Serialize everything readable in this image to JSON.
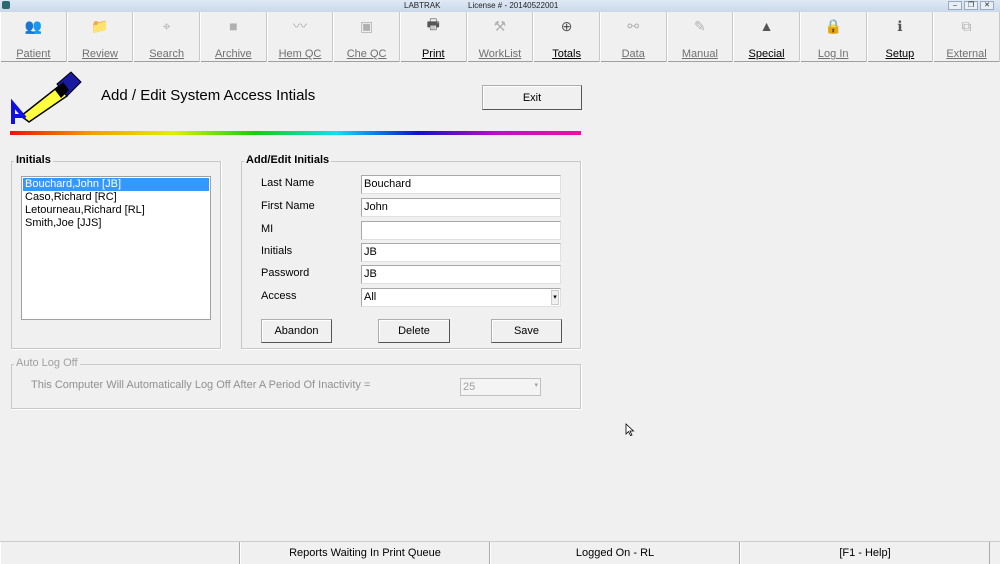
{
  "window": {
    "app_title": "LABTRAK",
    "license": "License # - 20140522001",
    "controls": [
      "minimize",
      "restore",
      "close"
    ]
  },
  "toolbar": [
    {
      "label": "Patient",
      "icon": "patient-icon",
      "glyph": "👥",
      "enabled": false
    },
    {
      "label": "Review",
      "icon": "review-icon",
      "glyph": "📁",
      "enabled": false
    },
    {
      "label": "Search",
      "icon": "search-icon",
      "glyph": "⌖",
      "enabled": false
    },
    {
      "label": "Archive",
      "icon": "archive-icon",
      "glyph": "■",
      "enabled": false
    },
    {
      "label": "Hem QC",
      "icon": "hem-qc-icon",
      "glyph": "〰",
      "enabled": false
    },
    {
      "label": "Che QC",
      "icon": "che-qc-icon",
      "glyph": "▣",
      "enabled": false
    },
    {
      "label": "Print",
      "icon": "printer-icon",
      "glyph": "🖶",
      "enabled": true
    },
    {
      "label": "WorkList",
      "icon": "worklist-icon",
      "glyph": "⚒",
      "enabled": false
    },
    {
      "label": "Totals",
      "icon": "totals-icon",
      "glyph": "⊕",
      "enabled": true
    },
    {
      "label": "Data",
      "icon": "data-icon",
      "glyph": "⚯",
      "enabled": false
    },
    {
      "label": "Manual",
      "icon": "manual-icon",
      "glyph": "✎",
      "enabled": false
    },
    {
      "label": "Special",
      "icon": "special-icon",
      "glyph": "▲",
      "enabled": true
    },
    {
      "label": "Log In",
      "icon": "lock-icon",
      "glyph": "🔒",
      "enabled": false
    },
    {
      "label": "Setup",
      "icon": "info-icon",
      "glyph": "ℹ",
      "enabled": true
    },
    {
      "label": "External",
      "icon": "external-icon",
      "glyph": "⧉",
      "enabled": false
    }
  ],
  "header": {
    "title": "Add / Edit System Access Intials",
    "exit_label": "Exit"
  },
  "initials": {
    "group_label": "Initials",
    "items": [
      "Bouchard,John [JB]",
      "Caso,Richard [RC]",
      "Letourneau,Richard [RL]",
      "Smith,Joe [JJS]"
    ],
    "selected_index": 0
  },
  "edit": {
    "group_label": "Add/Edit Initials",
    "fields": [
      {
        "label": "Last Name",
        "value": "Bouchard"
      },
      {
        "label": "First Name",
        "value": "John"
      },
      {
        "label": "MI",
        "value": ""
      },
      {
        "label": "Initials",
        "value": "JB"
      },
      {
        "label": "Password",
        "value": "JB"
      },
      {
        "label": "Access",
        "value": "All"
      }
    ],
    "abandon_label": "Abandon",
    "delete_label": "Delete",
    "save_label": "Save"
  },
  "auto_logoff": {
    "group_label": "Auto Log Off",
    "text": "This Computer Will Automatically Log Off After A Period Of Inactivity =",
    "value": "25"
  },
  "status": [
    "",
    "Reports Waiting In Print Queue",
    "Logged On - RL",
    "[F1 - Help]"
  ]
}
